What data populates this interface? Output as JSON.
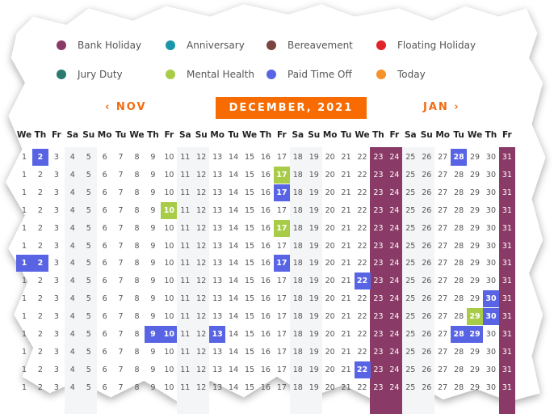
{
  "legend": [
    {
      "label": "Bank Holiday",
      "color": "#8a3a66"
    },
    {
      "label": "Anniversary",
      "color": "#1a96a8"
    },
    {
      "label": "Bereavement",
      "color": "#7a4440"
    },
    {
      "label": "Floating Holiday",
      "color": "#e0242a"
    },
    {
      "label": "Jury Duty",
      "color": "#2a7a6e"
    },
    {
      "label": "Mental Health",
      "color": "#a8cc48"
    },
    {
      "label": "Paid Time Off",
      "color": "#5864e4"
    },
    {
      "label": "Today",
      "color": "#f7922a"
    }
  ],
  "nav": {
    "prev_label": "‹ NOV",
    "current_month": "DECEMBER, 2021",
    "next_label": "JAN ›"
  },
  "weekdays": [
    "We",
    "Th",
    "Fr",
    "Sa",
    "Su",
    "Mo",
    "Tu",
    "We",
    "Th",
    "Fr",
    "Sa",
    "Su",
    "Mo",
    "Tu",
    "We",
    "Th",
    "Fr",
    "Sa",
    "Su",
    "Mo",
    "Tu",
    "We",
    "Th",
    "Fr",
    "Sa",
    "Su",
    "Mo",
    "Tu",
    "We",
    "Th",
    "Fr"
  ],
  "weekend_days": [
    4,
    5,
    11,
    12,
    18,
    19,
    25,
    26
  ],
  "bank_holidays": [
    23,
    24,
    31
  ],
  "colors": {
    "bank_holiday": "#8a3a66",
    "paid_time_off": "#5864e4",
    "mental_health": "#a8cc48",
    "weekend": "#f4f5f7"
  },
  "rows": [
    {
      "pto": [
        2,
        28
      ],
      "mental_health": []
    },
    {
      "pto": [],
      "mental_health": [
        17
      ]
    },
    {
      "pto": [
        17
      ],
      "mental_health": []
    },
    {
      "pto": [],
      "mental_health": [
        10
      ]
    },
    {
      "pto": [],
      "mental_health": [
        17
      ]
    },
    {
      "pto": [],
      "mental_health": []
    },
    {
      "pto": [
        1,
        2,
        17
      ],
      "mental_health": []
    },
    {
      "pto": [
        22
      ],
      "mental_health": []
    },
    {
      "pto": [
        30
      ],
      "mental_health": []
    },
    {
      "pto": [
        30
      ],
      "mental_health": [
        29
      ]
    },
    {
      "pto": [
        9,
        10,
        13,
        28,
        29
      ],
      "mental_health": []
    },
    {
      "pto": [],
      "mental_health": []
    },
    {
      "pto": [
        22
      ],
      "mental_health": []
    },
    {
      "pto": [],
      "mental_health": []
    }
  ]
}
